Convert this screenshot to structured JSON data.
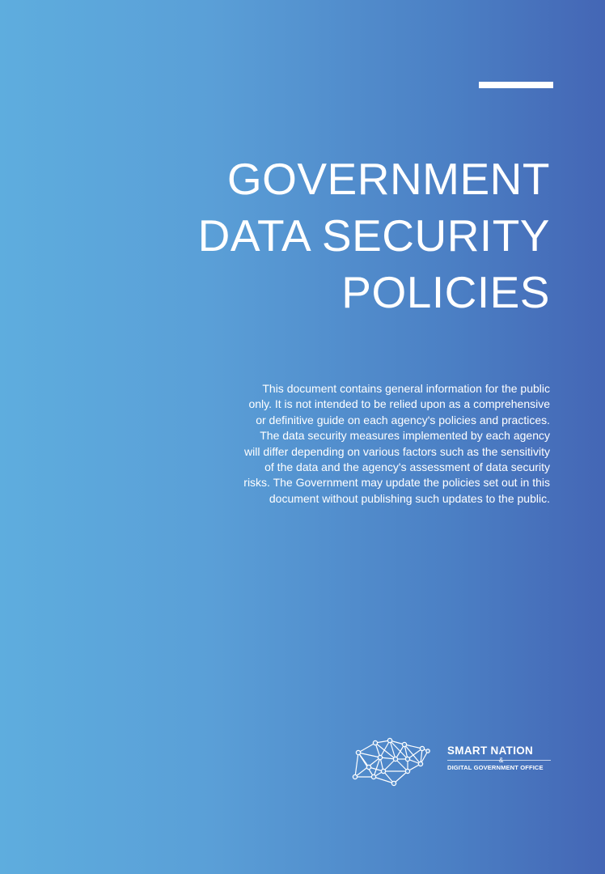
{
  "cover": {
    "title_lines": [
      "GOVERNMENT",
      "DATA SECURITY",
      "POLICIES"
    ],
    "disclaimer": "This document contains general information for the public only. It is not intended to be relied upon as a comprehensive or definitive guide on each agency's policies and practices. The data security measures implemented by each agency will differ depending on various factors such as the sensitivity of the data and the agency's assessment of data security risks. The Government may update the policies set out in this document without publishing such updates to the public."
  },
  "logo": {
    "icon": "network-nodes-icon",
    "line1": "SMART NATION",
    "ampersand": "&",
    "line2": "DIGITAL GOVERNMENT OFFICE"
  },
  "colors": {
    "gradient_left": "#5eadde",
    "gradient_right": "#4466b5",
    "text": "#ffffff"
  }
}
